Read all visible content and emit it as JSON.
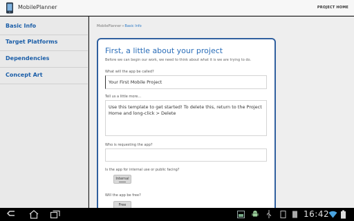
{
  "app": {
    "title": "MobilePlanner",
    "project_home": "PROJECT HOME"
  },
  "sidebar": {
    "items": [
      {
        "label": "Basic Info"
      },
      {
        "label": "Target Platforms"
      },
      {
        "label": "Dependencies"
      },
      {
        "label": "Concept Art"
      }
    ]
  },
  "breadcrumb": {
    "root": "MobilePlanner",
    "separator": "»",
    "current": "Basic Info"
  },
  "form": {
    "title": "First, a little about your project",
    "subtitle": "Before we can begin our work, we need to think about what it is we are trying to do.",
    "app_name": {
      "label": "What will the app be called?",
      "value": "Your First Mobile Project"
    },
    "description": {
      "label": "Tell us a little more...",
      "value": "Use this template to get started! To delete this, return to the Project Home and long-click > Delete"
    },
    "requester": {
      "label": "Who is requesting the app?",
      "value": ""
    },
    "facing": {
      "label": "Is the app for internal use or public facing?",
      "toggle": "Internal"
    },
    "pricing": {
      "label": "Will the app be free?",
      "toggle": "Free"
    }
  },
  "status": {
    "time": "16:42"
  },
  "colors": {
    "accent": "#2a6db8",
    "link": "#1b5ea8",
    "card_border": "#2f5f9e"
  }
}
